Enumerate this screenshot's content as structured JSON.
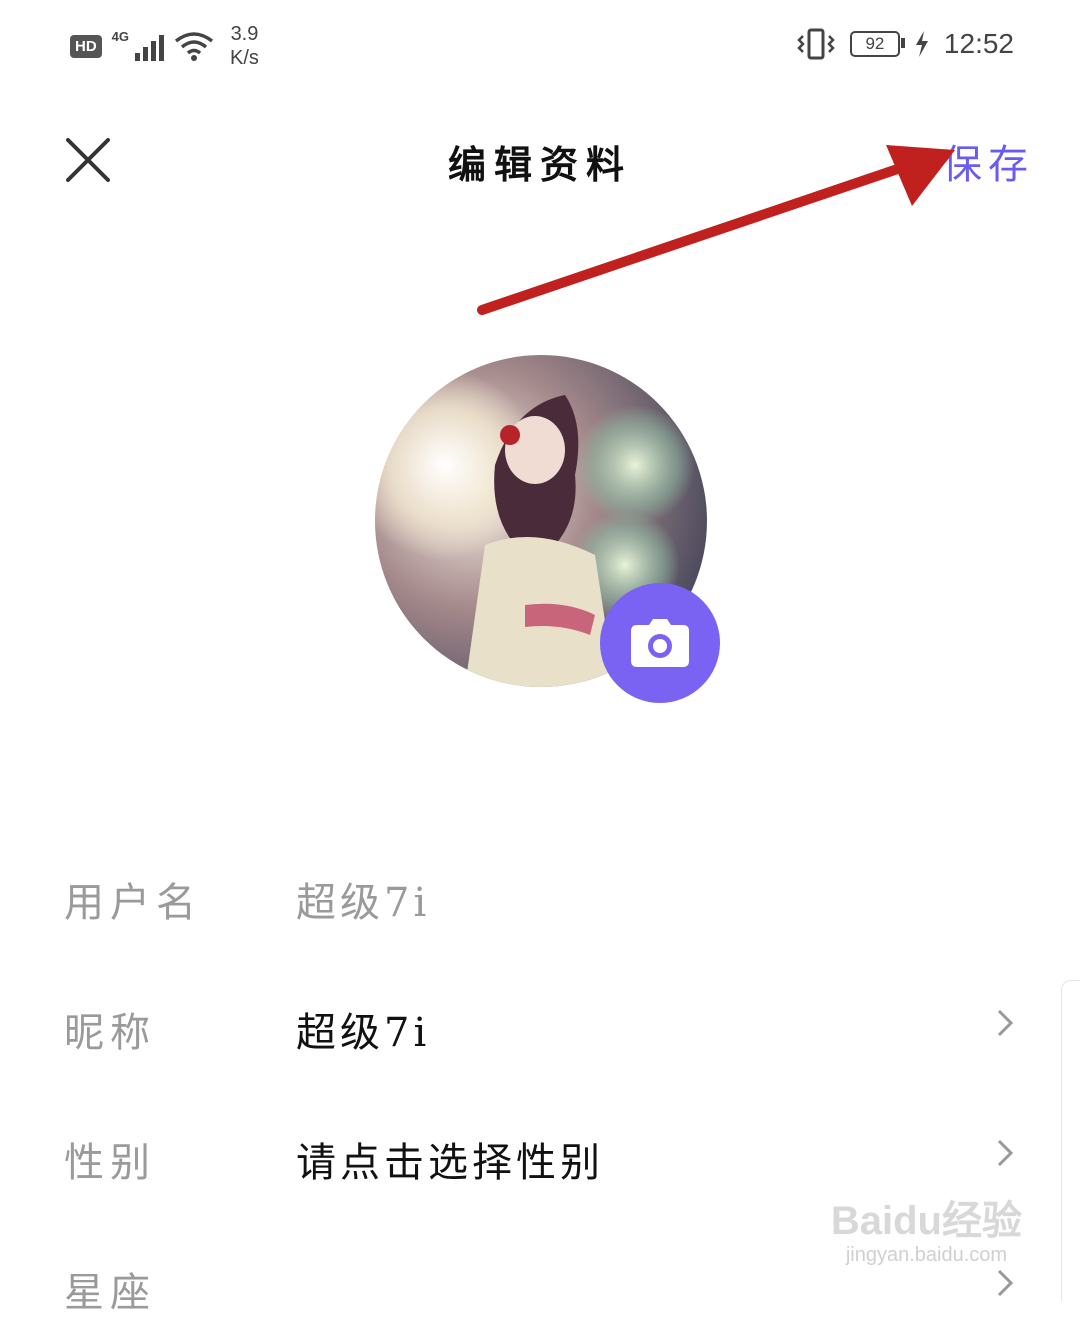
{
  "status_bar": {
    "hd": "HD",
    "network": "4G",
    "speed_value": "3.9",
    "speed_unit": "K/s",
    "battery": "92",
    "time": "12:52"
  },
  "header": {
    "title": "编辑资料",
    "save_label": "保存"
  },
  "form": {
    "rows": [
      {
        "label": "用户名",
        "value": "超级7i"
      },
      {
        "label": "昵称",
        "value": "超级7i"
      },
      {
        "label": "性别",
        "value": "请点击选择性别"
      },
      {
        "label": "星座",
        "value": ""
      }
    ]
  },
  "watermark": {
    "brand": "Baidu经验",
    "url": "jingyan.baidu.com"
  },
  "colors": {
    "accent": "#7a63f2",
    "annotation_arrow": "#c0201e"
  }
}
